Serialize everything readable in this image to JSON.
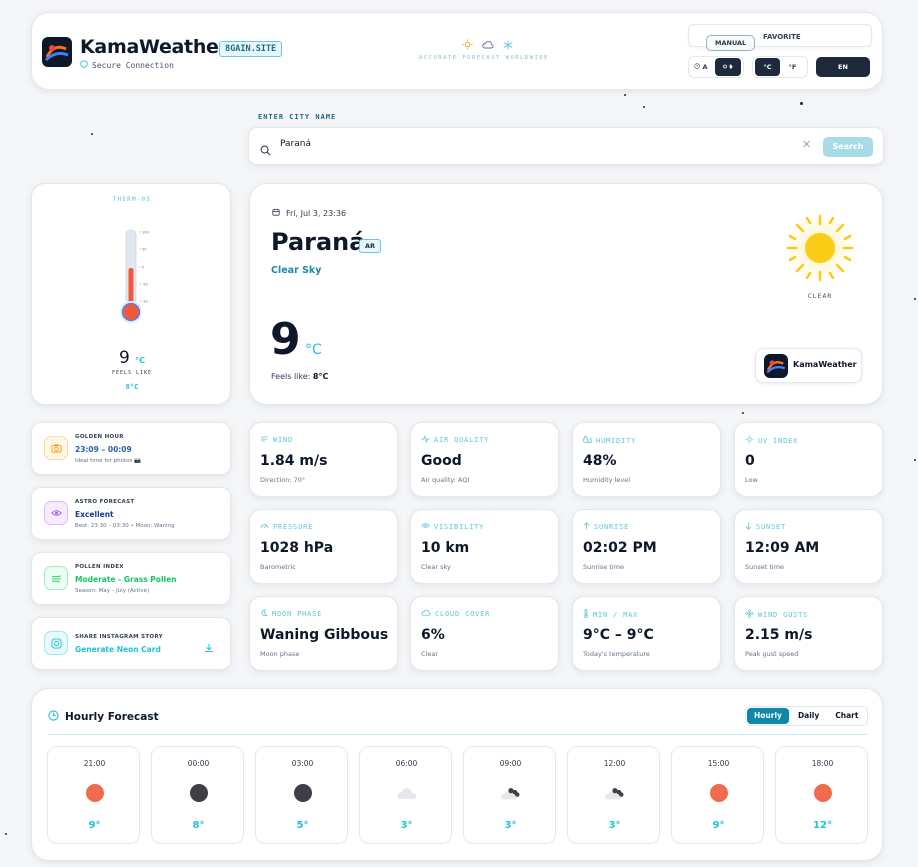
{
  "header": {
    "brand": "KamaWeather",
    "badge": "8GAIN.SITE",
    "secure": "Secure Connection",
    "tagline": "ACCURATE FORECAST WORLDWIDE",
    "mode_label": "MANUAL",
    "favorite_label": "FAVORITE",
    "theme_auto": "A",
    "unit_c": "°C",
    "unit_f": "°F",
    "lang": "EN"
  },
  "search": {
    "label": "ENTER CITY NAME",
    "value": "Paraná",
    "button": "Search"
  },
  "thermometer": {
    "title": "THERM-05",
    "temp": "9",
    "unit": "°C",
    "feels_label": "FEELS LIKE",
    "feels_value": "8°C",
    "level": 0.55
  },
  "current": {
    "date": "Fri, Jul 3, 23:36",
    "city": "Paraná",
    "country": "AR",
    "condition": "Clear Sky",
    "temp": "9",
    "unit": "°C",
    "feels_label": "Feels like:",
    "feels_value": "8°C",
    "icon_label": "CLEAR",
    "badge": "KamaWeather"
  },
  "side_cards": [
    {
      "label": "GOLDEN HOUR",
      "value": "23:09 – 00:09",
      "sub": "Ideal time for photos 📷",
      "color": "#2563a6"
    },
    {
      "label": "ASTRO FORECAST",
      "value": "Excellent",
      "sub": "Best: 23:30 – 03:30 • Moon: Waning",
      "color": "#1e3a8a"
    },
    {
      "label": "POLLEN INDEX",
      "value": "Moderate - Grass Pollen",
      "sub": "Season: May – July (Active)",
      "color": "#16a34a"
    },
    {
      "label": "SHARE INSTAGRAM STORY",
      "value": "Generate Neon Card",
      "sub": "",
      "color": "#22c1d8"
    }
  ],
  "metrics": [
    {
      "label": "WIND",
      "value": "1.84 m/s",
      "sub": "Direction: 70°"
    },
    {
      "label": "AIR QUALITY",
      "value": "Good",
      "sub": "Air quality: AQI"
    },
    {
      "label": "HUMIDITY",
      "value": "48%",
      "sub": "Humidity level"
    },
    {
      "label": "UV INDEX",
      "value": "0",
      "sub": "Low"
    },
    {
      "label": "PRESSURE",
      "value": "1028 hPa",
      "sub": "Barometric"
    },
    {
      "label": "VISIBILITY",
      "value": "10 km",
      "sub": "Clear sky"
    },
    {
      "label": "SUNRISE",
      "value": "02:02 PM",
      "sub": "Sunrise time"
    },
    {
      "label": "SUNSET",
      "value": "12:09 AM",
      "sub": "Sunset time"
    },
    {
      "label": "MOON PHASE",
      "value": "Waning Gibbous",
      "sub": "Moon phase"
    },
    {
      "label": "CLOUD COVER",
      "value": "6%",
      "sub": "Clear"
    },
    {
      "label": "MIN / MAX",
      "value": "9°C – 9°C",
      "sub": "Today's temperature"
    },
    {
      "label": "WIND GUSTS",
      "value": "2.15 m/s",
      "sub": "Peak gust speed"
    }
  ],
  "hourly": {
    "title": "Hourly Forecast",
    "tabs": [
      "Hourly",
      "Daily",
      "Chart"
    ],
    "items": [
      {
        "time": "21:00",
        "temp": "9°",
        "icon": "sun-icon"
      },
      {
        "time": "00:00",
        "temp": "8°",
        "icon": "moon-icon"
      },
      {
        "time": "03:00",
        "temp": "5°",
        "icon": "moon-icon"
      },
      {
        "time": "06:00",
        "temp": "3°",
        "icon": "cloud-icon"
      },
      {
        "time": "09:00",
        "temp": "3°",
        "icon": "clouds-icon"
      },
      {
        "time": "12:00",
        "temp": "3°",
        "icon": "clouds-icon"
      },
      {
        "time": "15:00",
        "temp": "9°",
        "icon": "sun-icon"
      },
      {
        "time": "18:00",
        "temp": "12°",
        "icon": "sun-icon"
      }
    ]
  }
}
